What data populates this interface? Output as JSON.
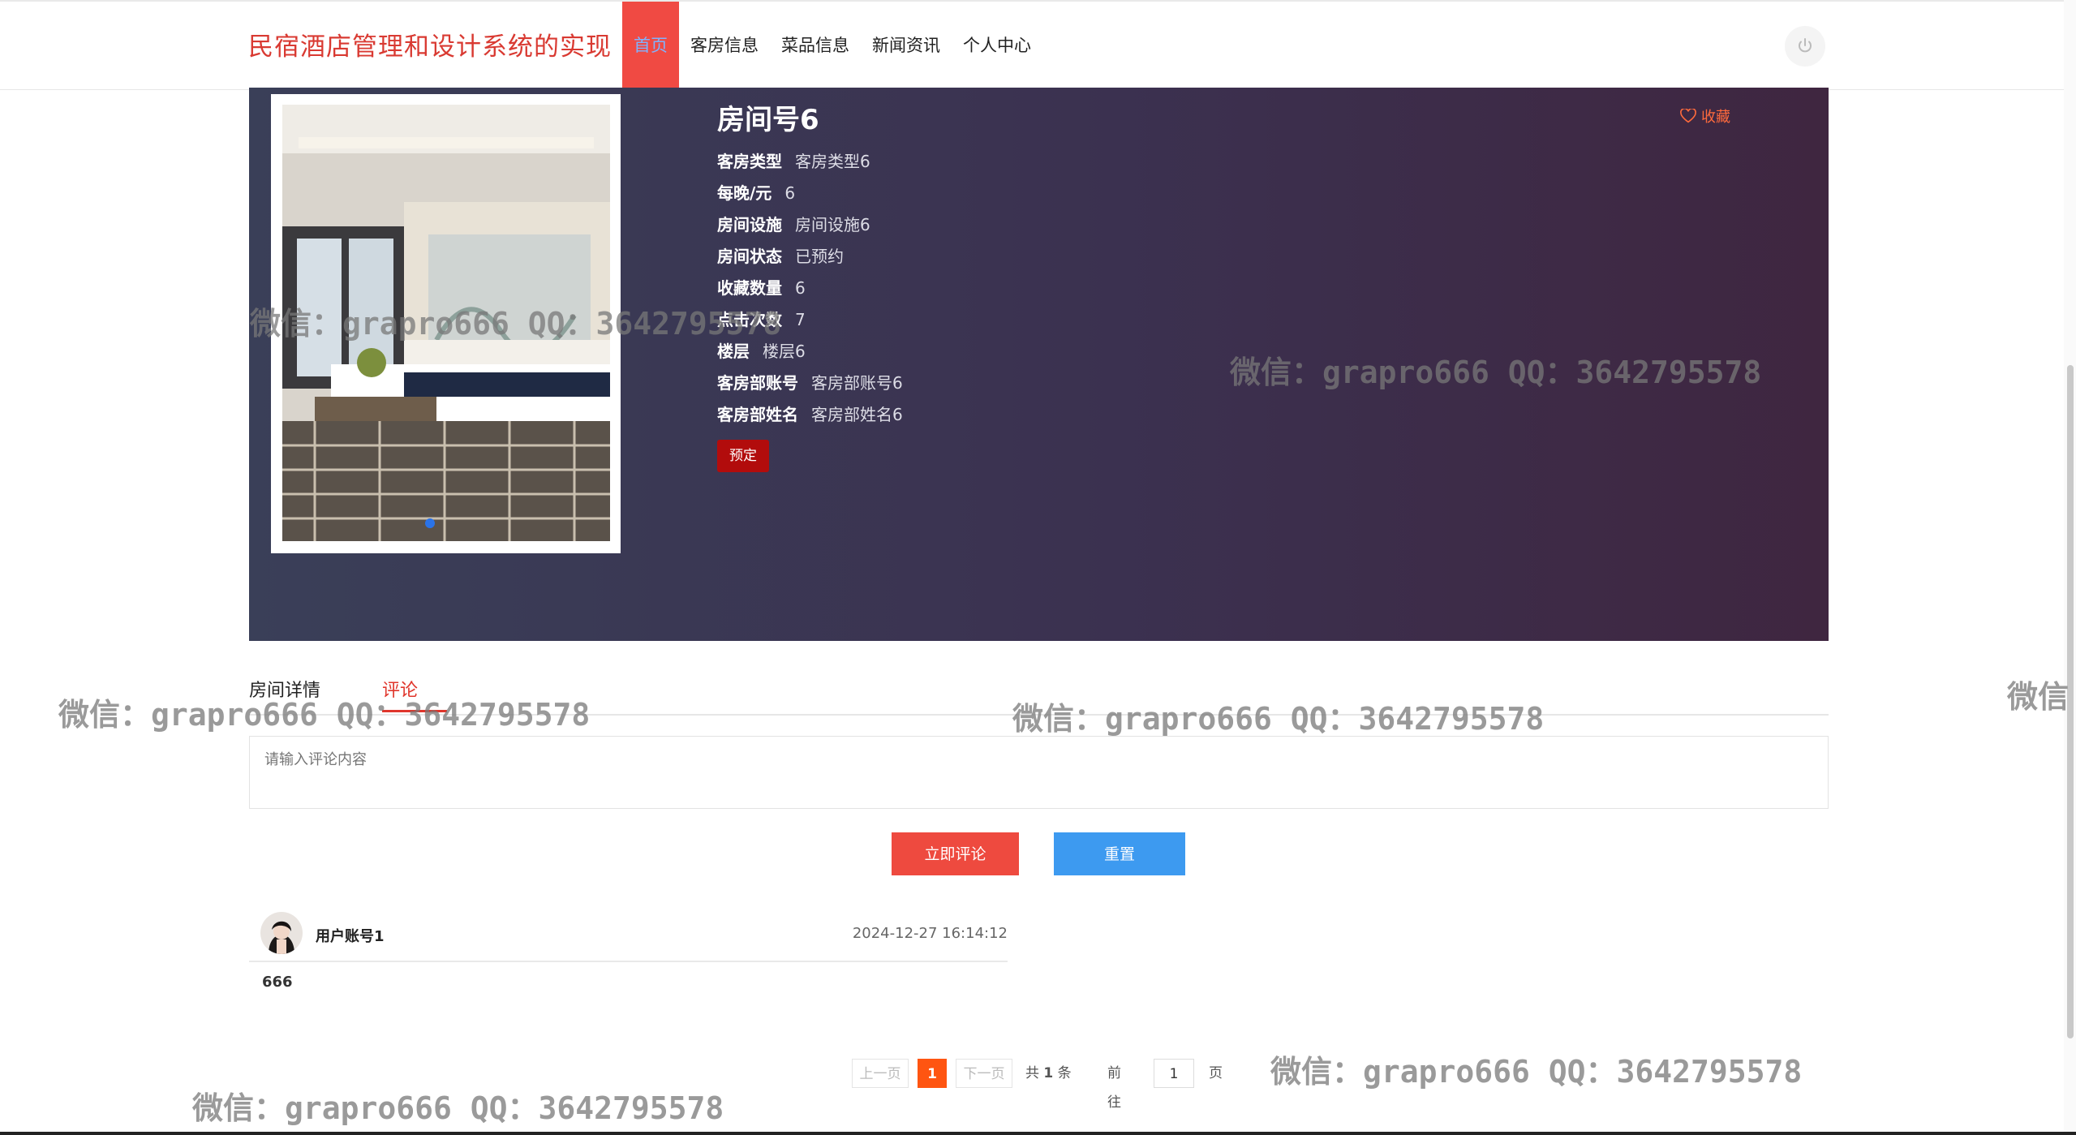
{
  "header": {
    "brand": "民宿酒店管理和设计系统的实现",
    "nav": [
      "首页",
      "客房信息",
      "菜品信息",
      "新闻资讯",
      "个人中心"
    ]
  },
  "room": {
    "title": "房间号6",
    "favorite_label": "收藏",
    "fields": [
      {
        "label": "客房类型",
        "value": "客房类型6"
      },
      {
        "label": "每晚/元",
        "value": "6"
      },
      {
        "label": "房间设施",
        "value": "房间设施6"
      },
      {
        "label": "房间状态",
        "value": "已预约"
      },
      {
        "label": "收藏数量",
        "value": "6"
      },
      {
        "label": "点击次数",
        "value": "7"
      },
      {
        "label": "楼层",
        "value": "楼层6"
      },
      {
        "label": "客房部账号",
        "value": "客房部账号6"
      },
      {
        "label": "客房部姓名",
        "value": "客房部姓名6"
      }
    ],
    "book_label": "预定"
  },
  "tabs": {
    "detail": "房间详情",
    "comment": "评论"
  },
  "comment_form": {
    "placeholder": "请输入评论内容",
    "submit_label": "立即评论",
    "reset_label": "重置"
  },
  "comments": [
    {
      "user": "用户账号1",
      "time": "2024-12-27 16:14:12",
      "text": "666"
    }
  ],
  "pager": {
    "prev": "上一页",
    "current": "1",
    "next": "下一页",
    "total_prefix": "共",
    "total": "1",
    "total_suffix": "条",
    "goto": "前往",
    "page_input": "1",
    "page_suffix": "页"
  },
  "watermark": "微信：grapro666 QQ：3642795578",
  "watermark_partial": "微信",
  "colors": {
    "brand": "#d93a32",
    "nav_active": "#f04a43",
    "book": "#b20c0c",
    "submit": "#ee4a3f",
    "reset": "#3d9af0",
    "page_current": "#ff5511"
  }
}
